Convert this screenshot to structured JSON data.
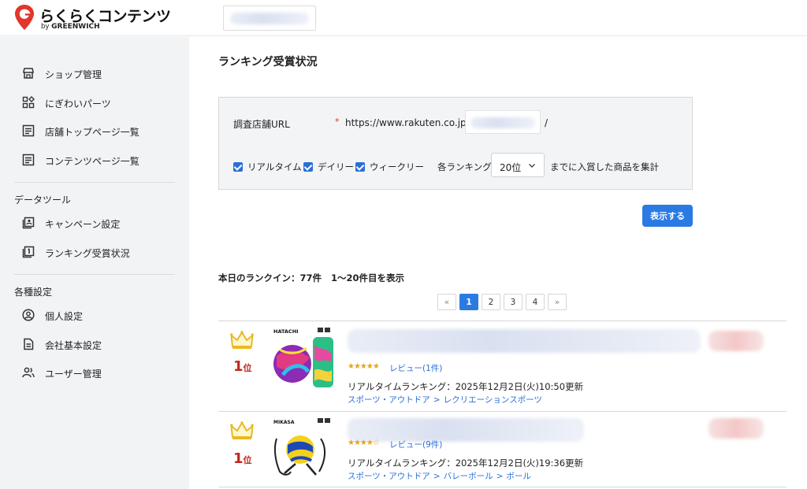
{
  "header": {
    "logo_text": "らくらくコンテンツ",
    "logo_sub_prefix": "by ",
    "logo_sub_brand": "GREENWICH"
  },
  "sidebar": {
    "items_main": [
      {
        "label": "ショップ管理",
        "icon": "store-icon"
      },
      {
        "label": "にぎわいパーツ",
        "icon": "widgets-icon"
      },
      {
        "label": "店舗トップページ一覧",
        "icon": "document-list-icon"
      },
      {
        "label": "コンテンツページ一覧",
        "icon": "document-list-icon"
      }
    ],
    "section_data": "データツール",
    "items_data": [
      {
        "label": "キャンペーン設定",
        "icon": "campaign-icon"
      },
      {
        "label": "ランキング受賞状況",
        "icon": "ranking-icon"
      }
    ],
    "section_settings": "各種設定",
    "items_settings": [
      {
        "label": "個人設定",
        "icon": "user-circle-icon"
      },
      {
        "label": "会社基本設定",
        "icon": "file-icon"
      },
      {
        "label": "ユーザー管理",
        "icon": "users-icon"
      }
    ]
  },
  "main": {
    "title": "ランキング受賞状況",
    "form": {
      "url_label": "調査店舗URL",
      "required_mark": "*",
      "url_prefix": "https://www.rakuten.co.jp/",
      "url_suffix": "/",
      "checkboxes": [
        {
          "label": "リアルタイム",
          "checked": true
        },
        {
          "label": "デイリー",
          "checked": true
        },
        {
          "label": "ウィークリー",
          "checked": true
        }
      ],
      "rank_prefix": "各ランキングの",
      "rank_value": "20位",
      "rank_suffix": "までに入賞した商品を集計"
    },
    "submit_label": "表示する",
    "summary": {
      "count_text": "本日のランクイン：77件",
      "range_text": "1〜20件目を表示"
    },
    "pagination": [
      "«",
      "1",
      "2",
      "3",
      "4",
      "»"
    ],
    "pagination_active": "1",
    "results": [
      {
        "rank": "1",
        "rank_suffix": "位",
        "stars": "★★★★★",
        "review": "レビュー(1件)",
        "ranking_line": "リアルタイムランキング：2025年12月2日(火)10:50更新",
        "breadcrumb": [
          "スポーツ・アウトドア",
          "レクリエーションスポーツ"
        ],
        "thumb_brand": "HATACHI"
      },
      {
        "rank": "1",
        "rank_suffix": "位",
        "stars": "★★★★☆",
        "review": "レビュー(9件)",
        "ranking_line": "リアルタイムランキング：2025年12月2日(火)19:36更新",
        "breadcrumb": [
          "スポーツ・アウトドア",
          "バレーボール",
          "ボール"
        ],
        "thumb_brand": "MIKASA"
      }
    ]
  },
  "colors": {
    "accent": "#2b7ae4",
    "logo_red": "#e2352b",
    "rank_red": "#c2271c",
    "crown_gold": "#e8b923",
    "link": "#2b6fd4"
  }
}
